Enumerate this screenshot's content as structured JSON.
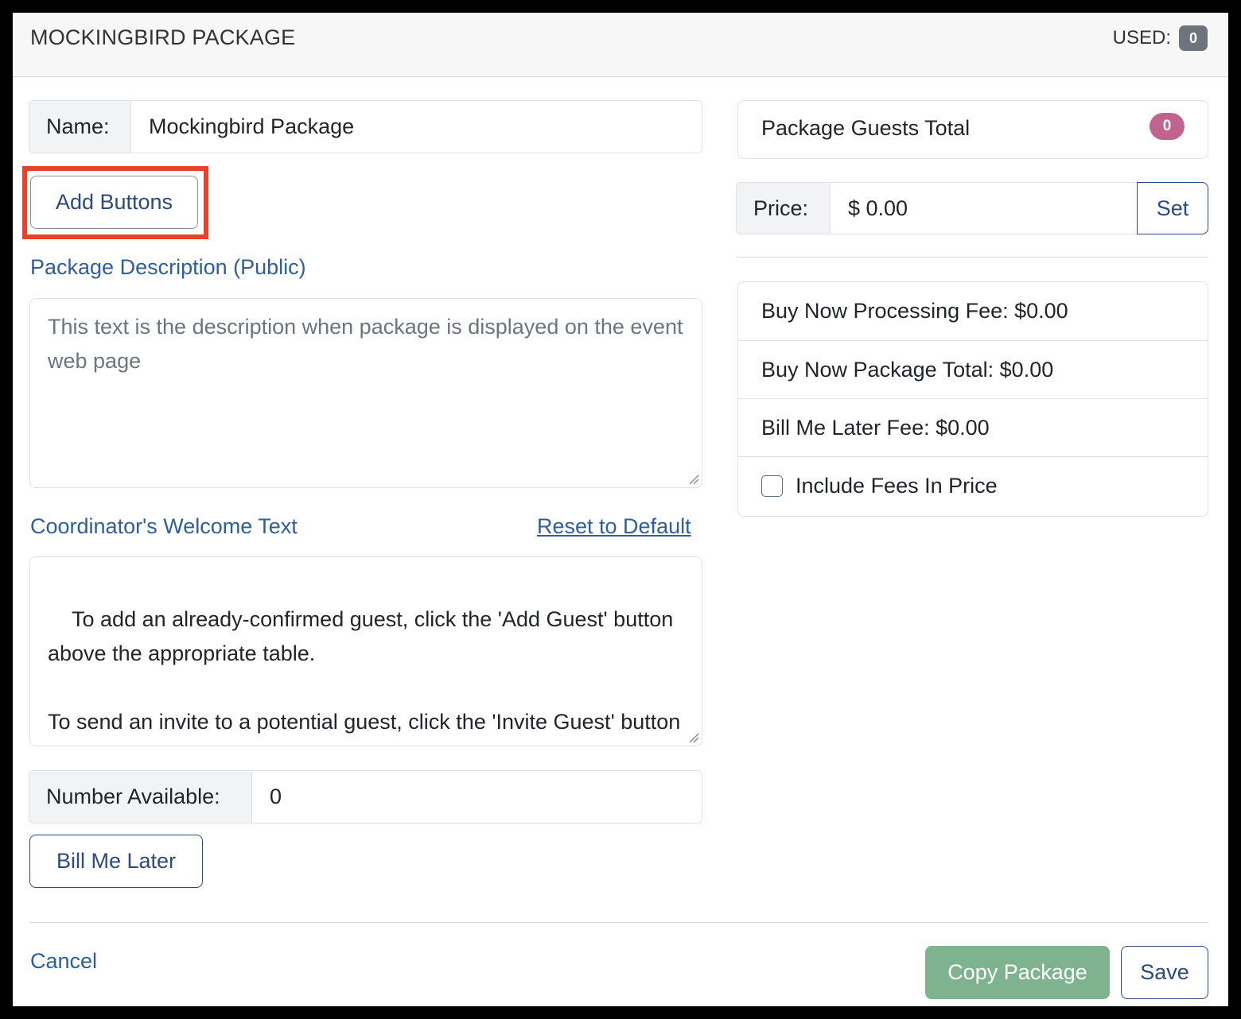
{
  "header": {
    "title": "MOCKINGBIRD PACKAGE",
    "used_label": "USED:",
    "used_count": "0"
  },
  "form": {
    "name_label": "Name:",
    "name_value": "Mockingbird Package",
    "add_buttons_label": "Add Buttons",
    "description_heading": "Package Description (Public)",
    "description_placeholder": "This text is the description when package is displayed on the event web page",
    "welcome_heading": "Coordinator's Welcome Text",
    "reset_link": "Reset to Default",
    "welcome_text": "To add an already-confirmed guest, click the 'Add Guest' button above the appropriate table.\n\nTo send an invite to a potential guest, click the 'Invite Guest' button above the appropriate table. The guest will receive an invite email from you containing a special online form.",
    "number_available_label": "Number Available:",
    "number_available_value": "0",
    "bill_me_later_label": "Bill Me Later"
  },
  "sidebar": {
    "guests_total_label": "Package Guests Total",
    "guests_total_count": "0",
    "price_label": "Price:",
    "price_value": "$ 0.00",
    "set_label": "Set",
    "fees": {
      "processing_fee": "Buy Now Processing Fee: $0.00",
      "package_total": "Buy Now Package Total: $0.00",
      "bill_later_fee": "Bill Me Later Fee: $0.00",
      "include_fees": "Include Fees In Price"
    }
  },
  "footer": {
    "cancel_label": "Cancel",
    "copy_label": "Copy Package",
    "save_label": "Save"
  },
  "colors": {
    "accent": "#2f5f96",
    "highlight": "#e8412c",
    "copy_button": "#7fb38f",
    "badge_pink": "#c2628f",
    "badge_gray": "#6c757d"
  }
}
